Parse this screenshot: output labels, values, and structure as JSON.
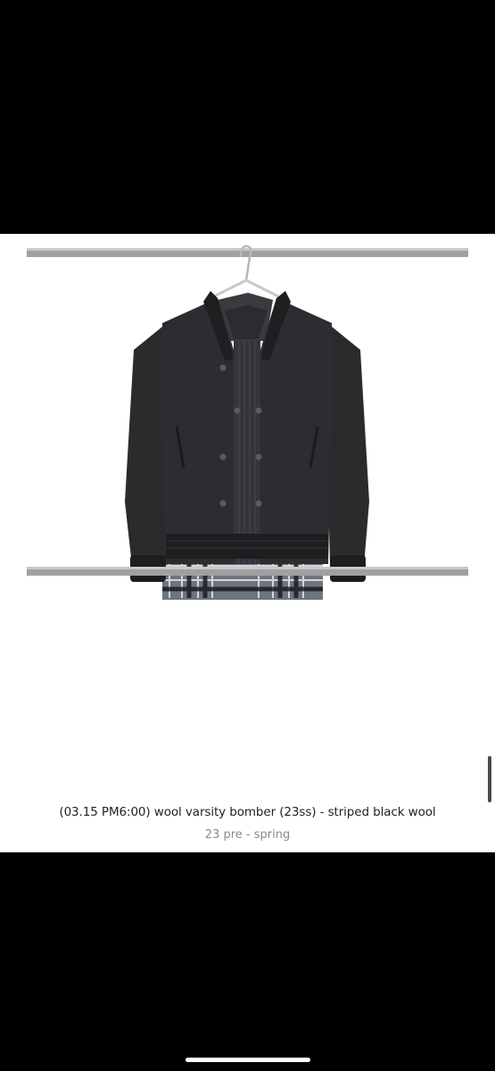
{
  "product": {
    "title": "(03.15 PM6:00) wool varsity bomber (23ss) - striped black wool",
    "subtitle": "23 pre - spring"
  },
  "colors": {
    "background": "#000000",
    "card": "#ffffff",
    "rack": "#9a9a9a",
    "jacket": "#2a2b2d",
    "caption": "#222222",
    "subcaption": "#8a8a8a"
  },
  "icons": {
    "scroll": "scroll-indicator",
    "home": "home-indicator"
  }
}
